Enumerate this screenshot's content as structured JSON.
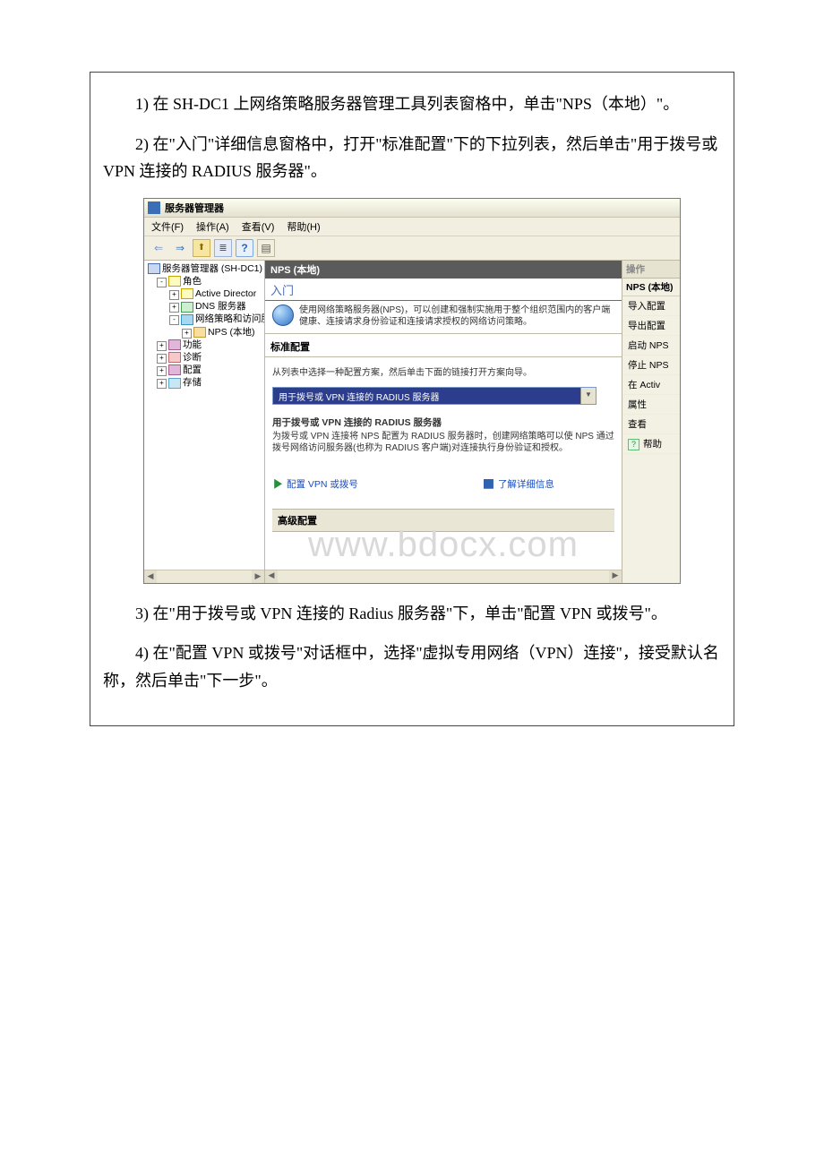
{
  "steps": {
    "s1": "1) 在 SH-DC1 上网络策略服务器管理工具列表窗格中，单击\"NPS（本地）\"。",
    "s2": "2) 在\"入门\"详细信息窗格中，打开\"标准配置\"下的下拉列表，然后单击\"用于拨号或 VPN 连接的 RADIUS 服务器\"。",
    "s3": "3) 在\"用于拨号或 VPN 连接的 Radius 服务器\"下，单击\"配置 VPN 或拨号\"。",
    "s4": "4) 在\"配置 VPN 或拨号\"对话框中，选择\"虚拟专用网络（VPN）连接\"，接受默认名称，然后单击\"下一步\"。"
  },
  "shot": {
    "title": "服务器管理器",
    "menus": {
      "file": "文件(F)",
      "action": "操作(A)",
      "view": "查看(V)",
      "help": "帮助(H)"
    },
    "tree": {
      "root": "服务器管理器 (SH-DC1)",
      "roles": "角色",
      "ad": "Active Director",
      "dns": "DNS 服务器",
      "npas": "网络策略和访问服",
      "nps": "NPS (本地)",
      "features": "功能",
      "diag": "诊断",
      "config": "配置",
      "storage": "存储"
    },
    "mid": {
      "header": "NPS (本地)",
      "intro": "入门",
      "desc": "使用网络策略服务器(NPS)，可以创建和强制实施用于整个组织范围内的客户端健康、连接请求身份验证和连接请求授权的网络访问策略。",
      "stdTitle": "标准配置",
      "stdDesc": "从列表中选择一种配置方案，然后单击下面的链接打开方案向导。",
      "ddSelected": "用于拨号或 VPN 连接的 RADIUS 服务器",
      "subH": "用于拨号或 VPN 连接的 RADIUS 服务器",
      "subP": "为拨号或 VPN 连接将 NPS 配置为 RADIUS 服务器时，创建网络策略可以使 NPS 通过拨号网络访问服务器(也称为 RADIUS 客户端)对连接执行身份验证和授权。",
      "link1": "配置 VPN 或拨号",
      "link2": "了解详细信息",
      "adv": "高级配置"
    },
    "actions": {
      "header": "操作",
      "sub": "NPS (本地)",
      "items": [
        "导入配置",
        "导出配置",
        "启动 NPS",
        "停止 NPS",
        "在 Activ",
        "属性",
        "查看"
      ],
      "help": "帮助"
    },
    "watermark": "www.bdocx.com"
  }
}
